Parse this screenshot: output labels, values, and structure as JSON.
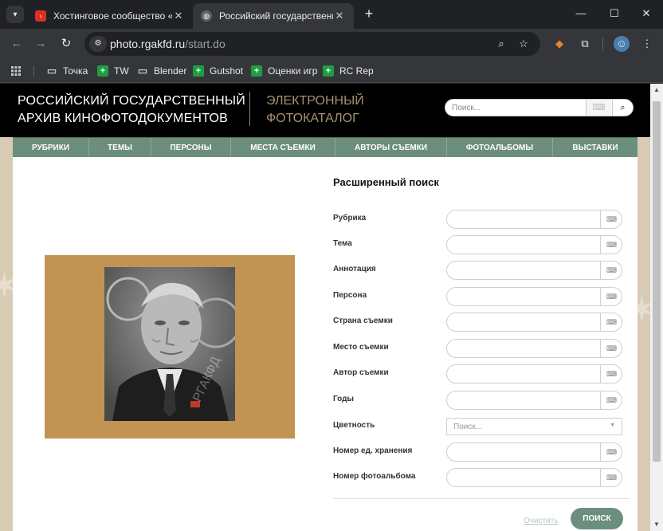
{
  "browser": {
    "tabs": [
      {
        "title": "Хостинговое сообщество «Tim",
        "favicon_color": "#d93025"
      },
      {
        "title": "Российский государственный",
        "favicon_color": "#5f6368"
      }
    ],
    "url_domain": "photo.rgakfd.ru",
    "url_path": "/start.do",
    "bookmarks": [
      "Точка",
      "TW",
      "Blender",
      "Gutshot",
      "Оценки игр",
      "RC Rep"
    ]
  },
  "site": {
    "logo_line1": "РОССИЙСКИЙ ГОСУДАРСТВЕННЫЙ",
    "logo_line2": "АРХИВ КИНОФОТОДОКУМЕНТОВ",
    "subtitle_line1": "ЭЛЕКТРОННЫЙ",
    "subtitle_line2": "ФОТОКАТАЛОГ",
    "search_placeholder": "Поиск...",
    "menu": [
      "РУБРИКИ",
      "ТЕМЫ",
      "ПЕРСОНЫ",
      "МЕСТА СЪЕМКИ",
      "АВТОРЫ СЪЕМКИ",
      "ФОТОАЛЬБОМЫ",
      "ВЫСТАВКИ"
    ]
  },
  "form": {
    "title": "Расширенный поиск",
    "fields": [
      "Рубрика",
      "Тема",
      "Аннотация",
      "Персона",
      "Страна съемки",
      "Место съемки",
      "Автор съемки",
      "Годы"
    ],
    "color_label": "Цветность",
    "color_placeholder": "Поиск...",
    "storage_label": "Номер ед. хранения",
    "album_label": "Номер фотоальбома",
    "clear_label": "Очистить",
    "search_label": "ПОИСК"
  },
  "colors": {
    "accent_green": "#6b8e7d",
    "header_black": "#000000",
    "photo_frame": "#c29453",
    "logo_gold": "#a59270"
  }
}
